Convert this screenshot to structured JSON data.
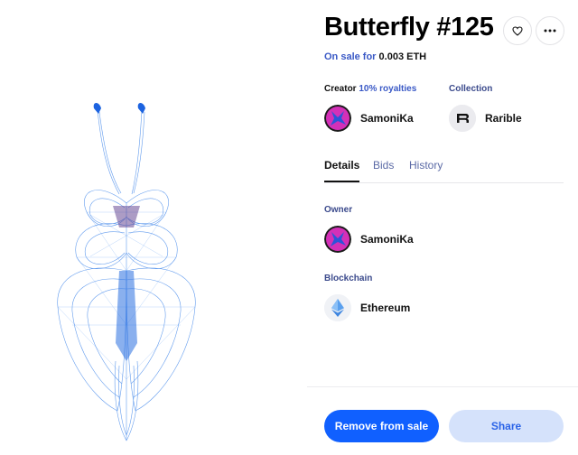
{
  "item": {
    "title": "Butterfly #125",
    "sale_prefix": "On sale for",
    "price": "0.003 ETH"
  },
  "creator": {
    "label": "Creator",
    "royalties": "10% royalties",
    "name": "SamoniKa"
  },
  "collection": {
    "label": "Collection",
    "name": "Rarible"
  },
  "tabs": [
    "Details",
    "Bids",
    "History"
  ],
  "details": {
    "owner_label": "Owner",
    "owner_name": "SamoniKa",
    "blockchain_label": "Blockchain",
    "blockchain_name": "Ethereum"
  },
  "actions": {
    "remove_label": "Remove from sale",
    "share_label": "Share"
  },
  "icons": {
    "favorite": "heart-icon",
    "more": "more-dots-icon",
    "chain": "ethereum-icon",
    "collection": "rarible-logo-icon"
  },
  "colors": {
    "accent": "#1060ff",
    "secondary_bg": "#d5e2fb",
    "label": "#3b4a8c",
    "art_line": "#2f7be8"
  }
}
